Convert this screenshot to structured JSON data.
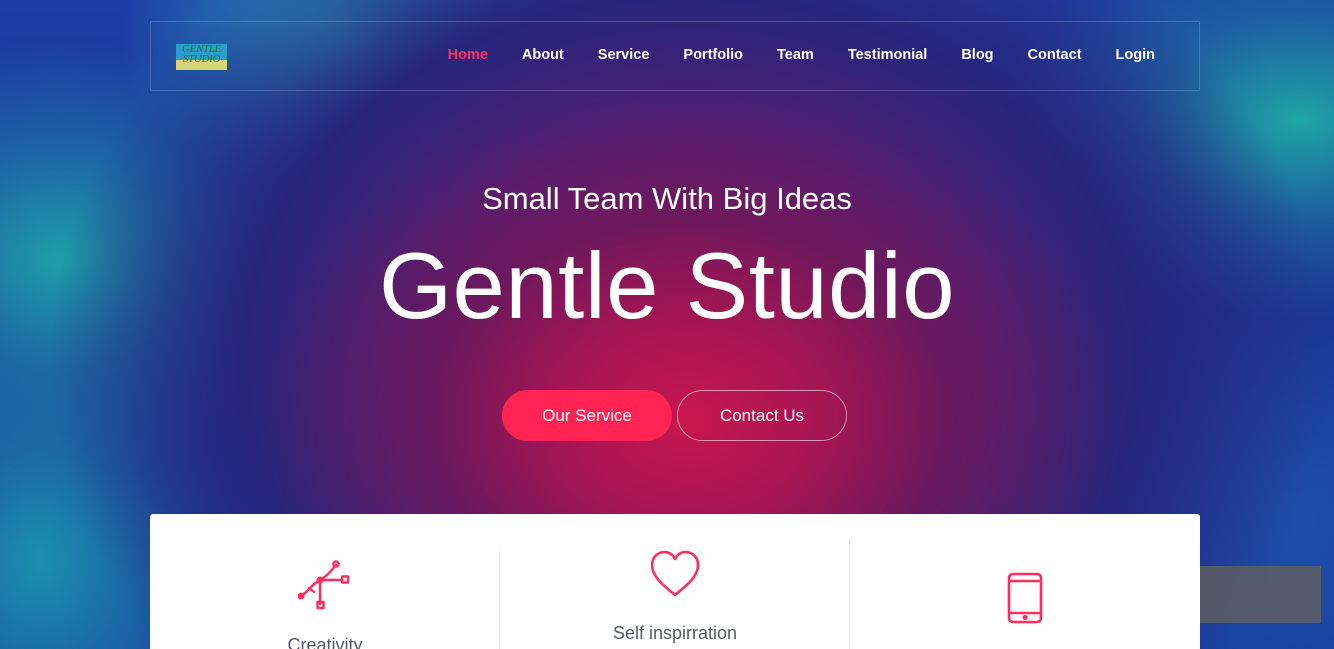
{
  "logo": {
    "text": "GENTLE STUDIO"
  },
  "nav": {
    "items": [
      {
        "label": "Home",
        "active": true
      },
      {
        "label": "About"
      },
      {
        "label": "Service"
      },
      {
        "label": "Portfolio"
      },
      {
        "label": "Team"
      },
      {
        "label": "Testimonial"
      },
      {
        "label": "Blog"
      },
      {
        "label": "Contact"
      },
      {
        "label": "Login"
      }
    ]
  },
  "hero": {
    "tagline": "Small Team With Big Ideas",
    "title": "Gentle Studio",
    "primary_button": "Our Service",
    "secondary_button": "Contact Us"
  },
  "features": [
    {
      "label": "Creativity",
      "icon": "vector-path-icon"
    },
    {
      "label": "Self inspirration",
      "icon": "heart-icon"
    },
    {
      "label": "",
      "icon": "mobile-phone-icon"
    }
  ],
  "colors": {
    "accent": "#ff2453",
    "nav_active": "#ff2e5e",
    "text_light": "#ffffff",
    "feature_text": "#555a60"
  }
}
